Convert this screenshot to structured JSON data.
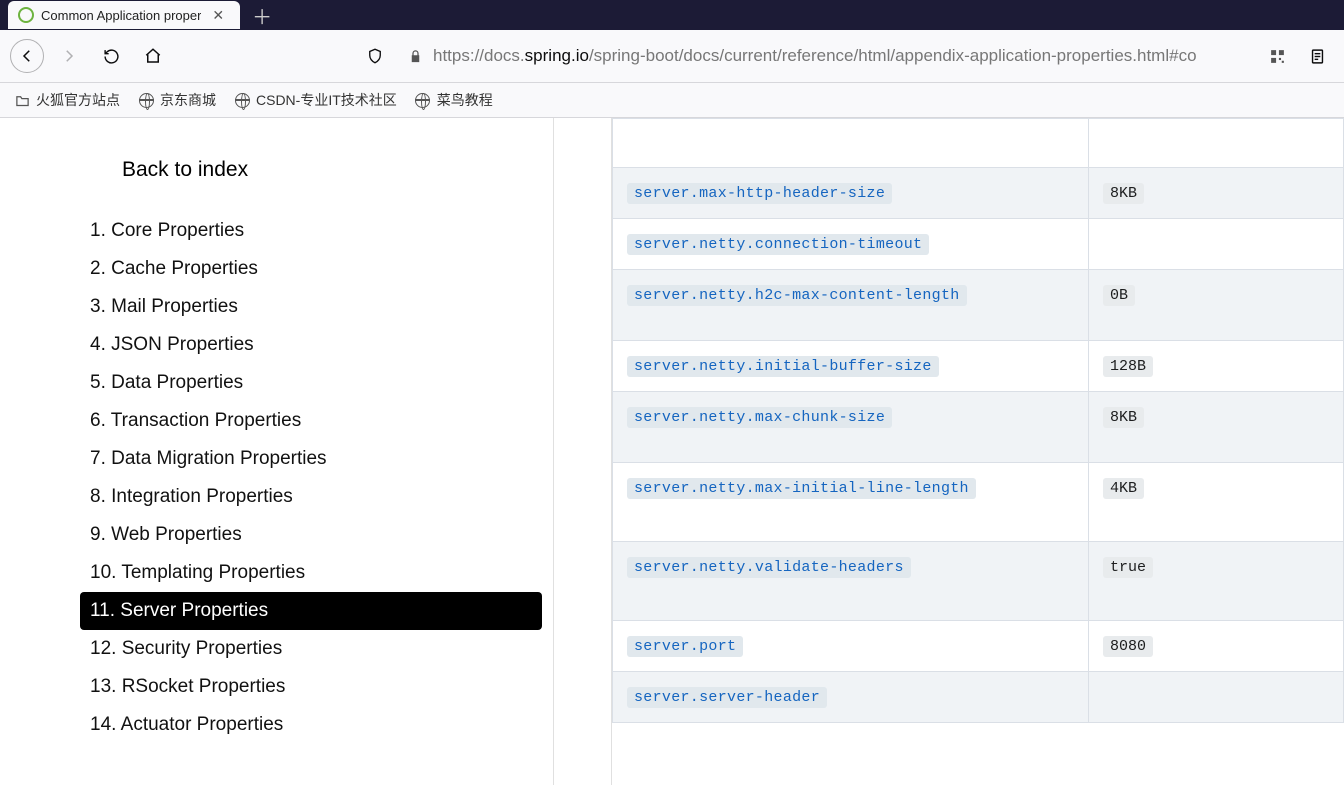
{
  "tab": {
    "title": "Common Application proper"
  },
  "url": {
    "prefix": "https://docs.",
    "host": "spring.io",
    "path": "/spring-boot/docs/current/reference/html/appendix-application-properties.html#co"
  },
  "bookmarks": [
    {
      "label": "火狐官方站点",
      "icon": "folder"
    },
    {
      "label": "京东商城",
      "icon": "globe"
    },
    {
      "label": "CSDN-专业IT技术社区",
      "icon": "globe"
    },
    {
      "label": "菜鸟教程",
      "icon": "globe"
    }
  ],
  "sidebar": {
    "back_label": "Back to index",
    "items": [
      "1. Core Properties",
      "2. Cache Properties",
      "3. Mail Properties",
      "4. JSON Properties",
      "5. Data Properties",
      "6. Transaction Properties",
      "7. Data Migration Properties",
      "8. Integration Properties",
      "9. Web Properties",
      "10. Templating Properties",
      "11. Server Properties",
      "12. Security Properties",
      "13. RSocket Properties",
      "14. Actuator Properties"
    ],
    "active_index": 10
  },
  "table": {
    "rows": [
      {
        "key": "",
        "value": ""
      },
      {
        "key": "server.max-http-header-size",
        "value": "8KB"
      },
      {
        "key": "server.netty.connection-timeout",
        "value": ""
      },
      {
        "key": "server.netty.h2c-max-content-length",
        "value": "0B"
      },
      {
        "key": "server.netty.initial-buffer-size",
        "value": "128B"
      },
      {
        "key": "server.netty.max-chunk-size",
        "value": "8KB"
      },
      {
        "key": "server.netty.max-initial-line-length",
        "value": "4KB"
      },
      {
        "key": "server.netty.validate-headers",
        "value": "true"
      },
      {
        "key": "server.port",
        "value": "8080"
      },
      {
        "key": "server.server-header",
        "value": ""
      }
    ]
  }
}
